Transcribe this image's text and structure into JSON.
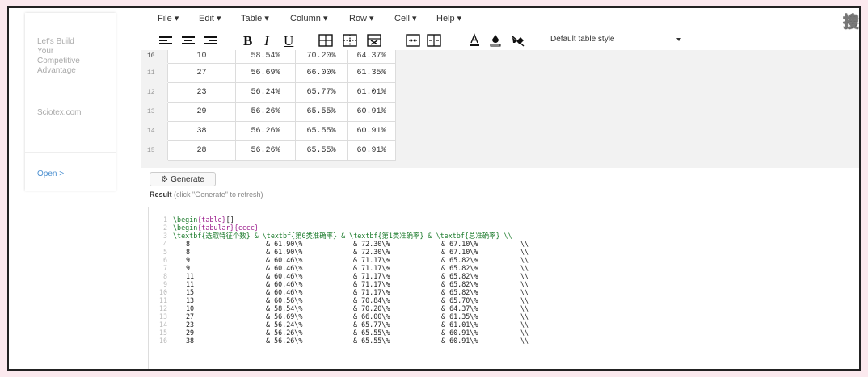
{
  "watermark": "搜狐号@数模乐园",
  "ad": {
    "tagline_lines": [
      "Let's Build",
      "Your",
      "Competitive",
      "Advantage"
    ],
    "site": "Sciotex.com",
    "open_label": "Open >"
  },
  "menu": [
    {
      "label": "File ▾"
    },
    {
      "label": "Edit ▾"
    },
    {
      "label": "Table ▾"
    },
    {
      "label": "Column ▾"
    },
    {
      "label": "Row ▾"
    },
    {
      "label": "Cell ▾"
    },
    {
      "label": "Help ▾"
    }
  ],
  "toolbar": {
    "bold": "B",
    "italic": "I",
    "underline": "U",
    "table_style": "Default table style"
  },
  "grid": {
    "rows": [
      {
        "n": "10",
        "cells": [
          "10",
          "58.54%",
          "70.20%",
          "64.37%"
        ]
      },
      {
        "n": "11",
        "cells": [
          "27",
          "56.69%",
          "66.00%",
          "61.35%"
        ]
      },
      {
        "n": "12",
        "cells": [
          "23",
          "56.24%",
          "65.77%",
          "61.01%"
        ]
      },
      {
        "n": "13",
        "cells": [
          "29",
          "56.26%",
          "65.55%",
          "60.91%"
        ]
      },
      {
        "n": "14",
        "cells": [
          "38",
          "56.26%",
          "65.55%",
          "60.91%"
        ]
      },
      {
        "n": "15",
        "cells": [
          "28",
          "56.26%",
          "65.55%",
          "60.91%"
        ]
      }
    ]
  },
  "generate": {
    "label": "Generate",
    "result_label": "Result",
    "result_hint": "(click \"Generate\" to refresh)"
  },
  "code": {
    "line1": {
      "cmd": "\\begin",
      "arg": "{table}",
      "rest": "[]"
    },
    "line2": {
      "cmd": "\\begin",
      "arg": "{tabular}",
      "rest": "{cccc}"
    },
    "line3": "\\textbf{选取特征个数} & \\textbf{第0类准确率} & \\textbf{第1类准确率} & \\textbf{总准确率} \\\\",
    "rows": [
      {
        "n": "4",
        "c": [
          "8",
          "& 61.90\\%",
          "& 72.30\\%",
          "& 67.10\\%",
          "\\\\"
        ]
      },
      {
        "n": "5",
        "c": [
          "8",
          "& 61.90\\%",
          "& 72.30\\%",
          "& 67.10\\%",
          "\\\\"
        ]
      },
      {
        "n": "6",
        "c": [
          "9",
          "& 60.46\\%",
          "& 71.17\\%",
          "& 65.82\\%",
          "\\\\"
        ]
      },
      {
        "n": "7",
        "c": [
          "9",
          "& 60.46\\%",
          "& 71.17\\%",
          "& 65.82\\%",
          "\\\\"
        ]
      },
      {
        "n": "8",
        "c": [
          "11",
          "& 60.46\\%",
          "& 71.17\\%",
          "& 65.82\\%",
          "\\\\"
        ]
      },
      {
        "n": "9",
        "c": [
          "11",
          "& 60.46\\%",
          "& 71.17\\%",
          "& 65.82\\%",
          "\\\\"
        ]
      },
      {
        "n": "10",
        "c": [
          "15",
          "& 60.46\\%",
          "& 71.17\\%",
          "& 65.82\\%",
          "\\\\"
        ]
      },
      {
        "n": "11",
        "c": [
          "13",
          "& 60.56\\%",
          "& 70.84\\%",
          "& 65.70\\%",
          "\\\\"
        ]
      },
      {
        "n": "12",
        "c": [
          "10",
          "& 58.54\\%",
          "& 70.20\\%",
          "& 64.37\\%",
          "\\\\"
        ]
      },
      {
        "n": "13",
        "c": [
          "27",
          "& 56.69\\%",
          "& 66.00\\%",
          "& 61.35\\%",
          "\\\\"
        ]
      },
      {
        "n": "14",
        "c": [
          "23",
          "& 56.24\\%",
          "& 65.77\\%",
          "& 61.01\\%",
          "\\\\"
        ]
      },
      {
        "n": "15",
        "c": [
          "29",
          "& 56.26\\%",
          "& 65.55\\%",
          "& 60.91\\%",
          "\\\\"
        ]
      },
      {
        "n": "16",
        "c": [
          "38",
          "& 56.26\\%",
          "& 65.55\\%",
          "& 60.91\\%",
          "\\\\"
        ]
      }
    ]
  },
  "colors": {
    "page_bg": "#fbe9ee",
    "latex_command": "#1a7a2a",
    "latex_argument": "#9b1b8c",
    "link_blue": "#4a8fd0"
  },
  "icons": {
    "align": [
      "align-left-icon",
      "align-center-icon",
      "align-right-icon"
    ],
    "table": [
      "table-insert-icon",
      "table-dashed-icon",
      "table-merge-icon",
      "table-split-icon",
      "column-split-icon"
    ],
    "format": [
      "text-color-icon",
      "background-color-icon",
      "clear-format-icon"
    ]
  }
}
